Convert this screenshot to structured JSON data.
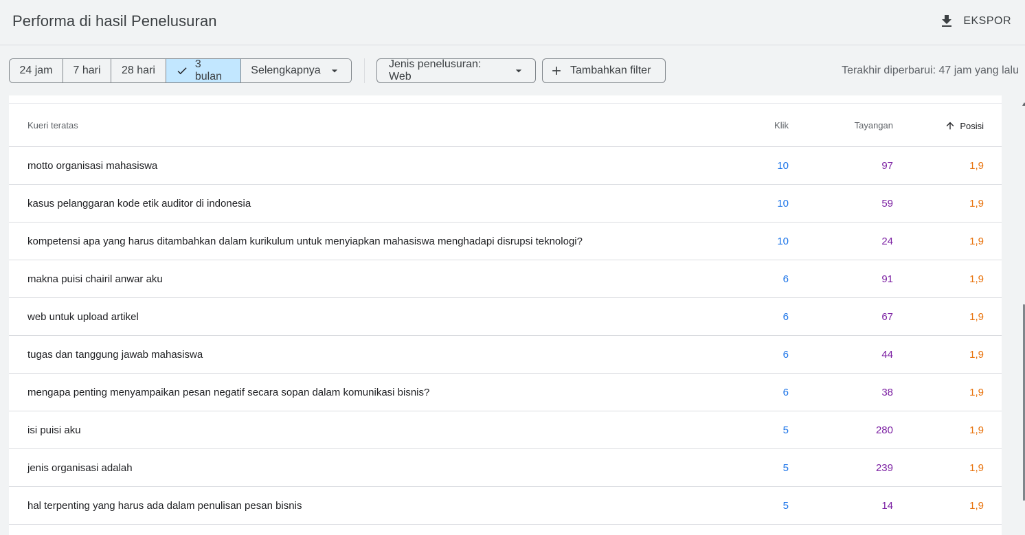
{
  "header": {
    "title": "Performa di hasil Penelusuran",
    "export_label": "EKSPOR"
  },
  "filters": {
    "date_ranges": [
      "24 jam",
      "7 hari",
      "28 hari",
      "3 bulan",
      "Selengkapnya"
    ],
    "selected_range": "3 bulan",
    "search_type": "Jenis penelusuran: Web",
    "add_filter": "Tambahkan filter",
    "last_updated": "Terakhir diperbarui: 47 jam yang lalu"
  },
  "table": {
    "headers": {
      "query": "Kueri teratas",
      "clicks": "Klik",
      "impressions": "Tayangan",
      "position": "Posisi"
    },
    "rows": [
      {
        "query": "motto organisasi mahasiswa",
        "clicks": "10",
        "impressions": "97",
        "position": "1,9"
      },
      {
        "query": "kasus pelanggaran kode etik auditor di indonesia",
        "clicks": "10",
        "impressions": "59",
        "position": "1,9"
      },
      {
        "query": "kompetensi apa yang harus ditambahkan dalam kurikulum untuk menyiapkan mahasiswa menghadapi disrupsi teknologi?",
        "clicks": "10",
        "impressions": "24",
        "position": "1,9"
      },
      {
        "query": "makna puisi chairil anwar aku",
        "clicks": "6",
        "impressions": "91",
        "position": "1,9"
      },
      {
        "query": "web untuk upload artikel",
        "clicks": "6",
        "impressions": "67",
        "position": "1,9"
      },
      {
        "query": "tugas dan tanggung jawab mahasiswa",
        "clicks": "6",
        "impressions": "44",
        "position": "1,9"
      },
      {
        "query": "mengapa penting menyampaikan pesan negatif secara sopan dalam komunikasi bisnis?",
        "clicks": "6",
        "impressions": "38",
        "position": "1,9"
      },
      {
        "query": "isi puisi aku",
        "clicks": "5",
        "impressions": "280",
        "position": "1,9"
      },
      {
        "query": "jenis organisasi adalah",
        "clicks": "5",
        "impressions": "239",
        "position": "1,9"
      },
      {
        "query": "hal terpenting yang harus ada dalam penulisan pesan bisnis",
        "clicks": "5",
        "impressions": "14",
        "position": "1,9"
      }
    ]
  },
  "colors": {
    "clicks": "#1a73e8",
    "impressions": "#7b1fa2",
    "position": "#e8710a",
    "selected_chip": "#c2e7ff"
  },
  "icons": {
    "export": "download-icon",
    "check": "check-icon",
    "caret": "caret-down-icon",
    "add": "plus-icon",
    "sort": "arrow-up-icon"
  }
}
